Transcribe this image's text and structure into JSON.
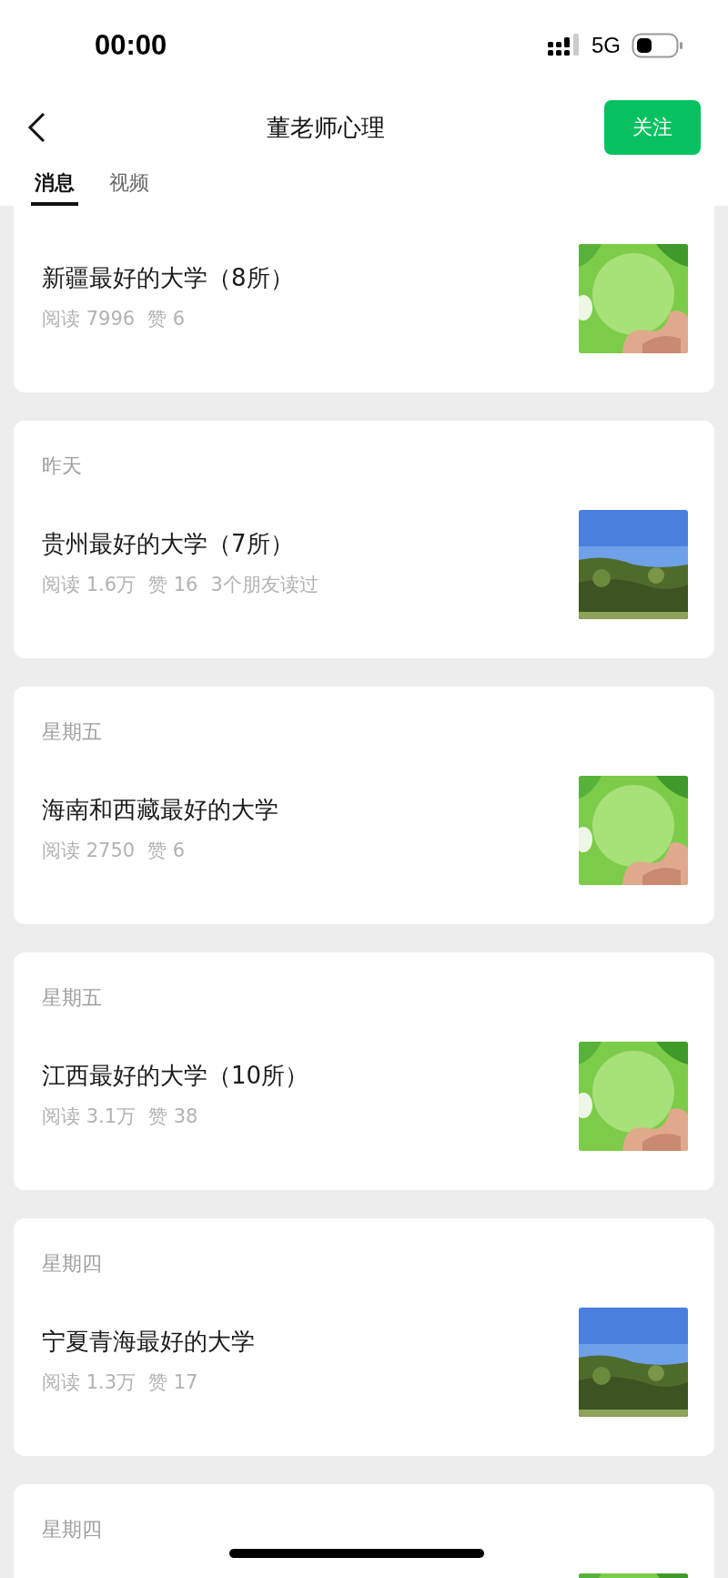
{
  "status_bar": {
    "time": "00:00",
    "network": "5G"
  },
  "header": {
    "title": "董老师心理",
    "follow_button": "关注"
  },
  "tabs": [
    {
      "label": "消息",
      "selected": true
    },
    {
      "label": "视频",
      "selected": false
    }
  ],
  "articles": [
    {
      "title": "新疆最好的大学（8所）",
      "stats": [
        "阅读 7996",
        "赞 6"
      ]
    },
    {
      "date": "昨天",
      "title": "贵州最好的大学（7所）",
      "stats": [
        "阅读 1.6万",
        "赞 16",
        "3个朋友读过"
      ]
    },
    {
      "date": "星期五",
      "title": "海南和西藏最好的大学",
      "stats": [
        "阅读 2750",
        "赞 6"
      ]
    },
    {
      "date": "星期五",
      "title": "江西最好的大学（10所）",
      "stats": [
        "阅读 3.1万",
        "赞 38"
      ]
    },
    {
      "date": "星期四",
      "title": "宁夏青海最好的大学",
      "stats": [
        "阅读 1.3万",
        "赞 17"
      ]
    },
    {
      "date": "星期四"
    }
  ]
}
